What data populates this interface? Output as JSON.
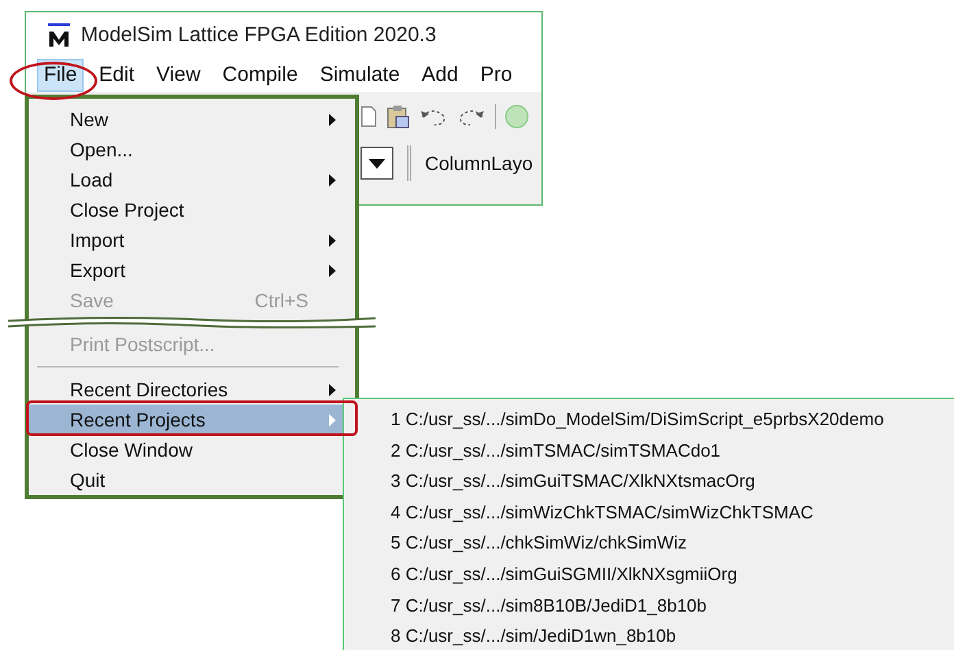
{
  "window": {
    "title": "ModelSim Lattice FPGA Edition 2020.3"
  },
  "menubar": [
    {
      "label": "File",
      "selected": true
    },
    {
      "label": "Edit",
      "selected": false
    },
    {
      "label": "View",
      "selected": false
    },
    {
      "label": "Compile",
      "selected": false
    },
    {
      "label": "Simulate",
      "selected": false
    },
    {
      "label": "Add",
      "selected": false
    },
    {
      "label": "Pro",
      "selected": false
    }
  ],
  "toolbar": {
    "layout_label": "ColumnLayo"
  },
  "file_menu": [
    {
      "kind": "item",
      "label": "New",
      "submenu": true,
      "disabled": false,
      "selected": false
    },
    {
      "kind": "item",
      "label": "Open...",
      "submenu": false,
      "disabled": false,
      "selected": false
    },
    {
      "kind": "item",
      "label": "Load",
      "submenu": true,
      "disabled": false,
      "selected": false
    },
    {
      "kind": "item",
      "label": "Close Project",
      "submenu": false,
      "disabled": false,
      "selected": false
    },
    {
      "kind": "item",
      "label": "Import",
      "submenu": true,
      "disabled": false,
      "selected": false
    },
    {
      "kind": "item",
      "label": "Export",
      "submenu": true,
      "disabled": false,
      "selected": false
    },
    {
      "kind": "item",
      "label": "Save",
      "shortcut": "Ctrl+S",
      "submenu": false,
      "disabled": true,
      "selected": false
    },
    {
      "kind": "break"
    },
    {
      "kind": "item",
      "label": "Print Postscript...",
      "submenu": false,
      "disabled": true,
      "selected": false
    },
    {
      "kind": "separator"
    },
    {
      "kind": "item",
      "label": "Recent Directories",
      "submenu": true,
      "disabled": false,
      "selected": false
    },
    {
      "kind": "item",
      "label": "Recent Projects",
      "submenu": true,
      "disabled": false,
      "selected": true
    },
    {
      "kind": "item",
      "label": "Close Window",
      "submenu": false,
      "disabled": false,
      "selected": false
    },
    {
      "kind": "item",
      "label": "Quit",
      "submenu": false,
      "disabled": false,
      "selected": false
    }
  ],
  "recent_projects": [
    "1 C:/usr_ss/.../simDo_ModelSim/DiSimScript_e5prbsX20demo",
    "2 C:/usr_ss/.../simTSMAC/simTSMACdo1",
    "3 C:/usr_ss/.../simGuiTSMAC/XlkNXtsmacOrg",
    "4 C:/usr_ss/.../simWizChkTSMAC/simWizChkTSMAC",
    "5 C:/usr_ss/.../chkSimWiz/chkSimWiz",
    "6 C:/usr_ss/.../simGuiSGMII/XlkNXsgmiiOrg",
    "7 C:/usr_ss/.../sim8B10B/JediD1_8b10b",
    "8 C:/usr_ss/.../sim/JediD1wn_8b10b"
  ]
}
